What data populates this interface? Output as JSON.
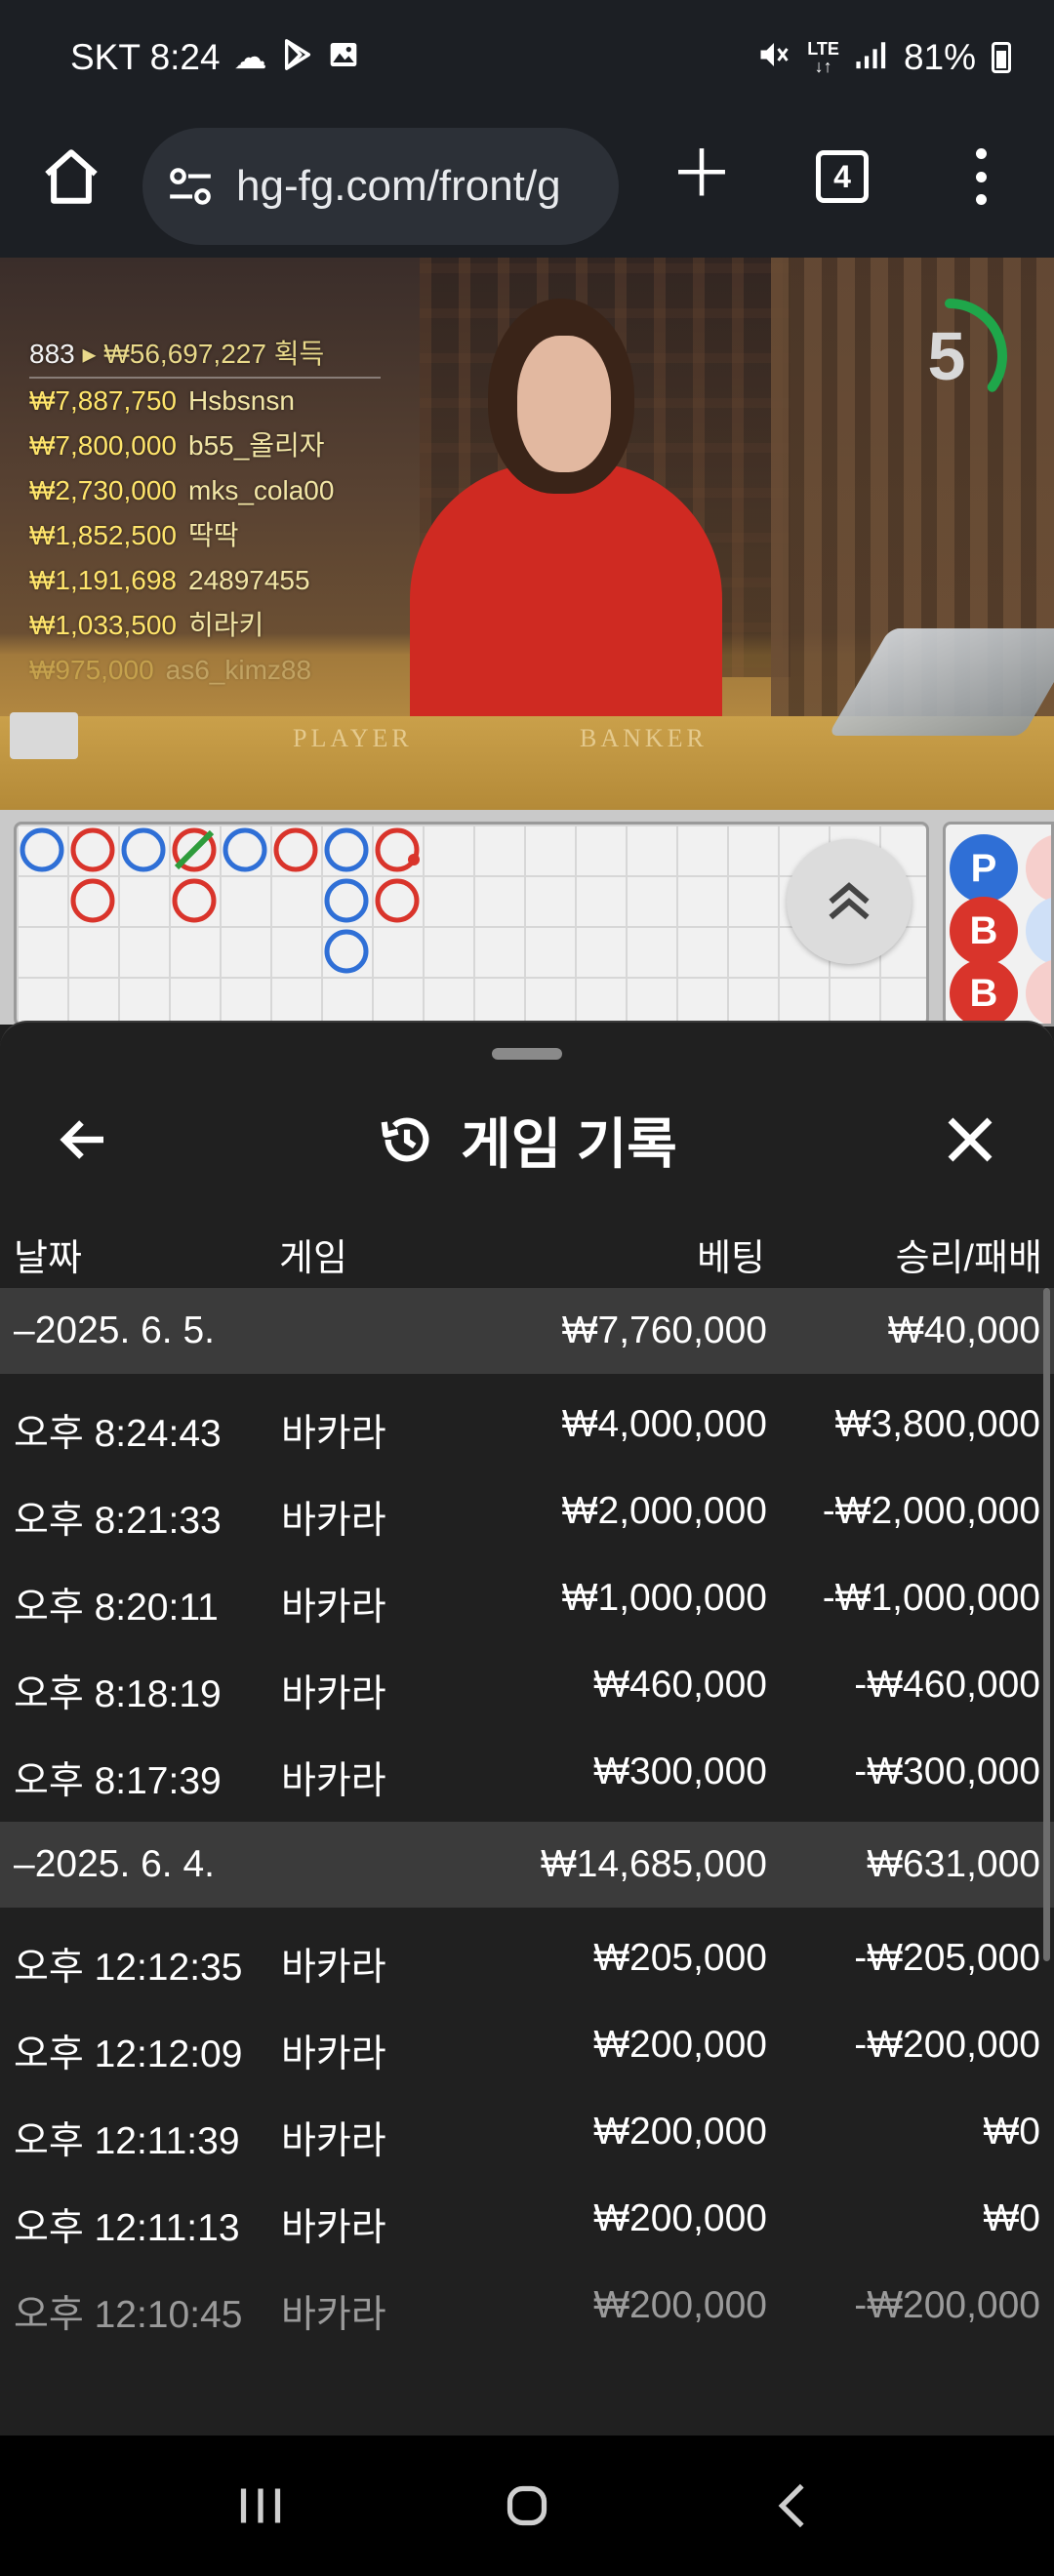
{
  "status_bar": {
    "carrier_time": "SKT 8:24",
    "left_icons": [
      "cloud-icon",
      "play-store-icon",
      "image-icon"
    ],
    "right_icons": [
      "mute-icon",
      "lte-icon",
      "signal-icon"
    ],
    "battery": "81%"
  },
  "browser": {
    "url": "hg-fg.com/front/g",
    "tab_count": "4"
  },
  "video": {
    "winners_header": {
      "count": "883",
      "total": "₩56,697,227",
      "suffix": "획득"
    },
    "winners": [
      {
        "amount": "₩7,887,750",
        "name": "Hsbsnsn"
      },
      {
        "amount": "₩7,800,000",
        "name": "b55_올리자"
      },
      {
        "amount": "₩2,730,000",
        "name": "mks_cola00"
      },
      {
        "amount": "₩1,852,500",
        "name": "딱딱"
      },
      {
        "amount": "₩1,191,698",
        "name": "24897455"
      },
      {
        "amount": "₩1,033,500",
        "name": "히라키"
      },
      {
        "amount": "₩975,000",
        "name": "as6_kimz88"
      }
    ],
    "table_labels": {
      "player": "PLAYER",
      "banker": "BANKER"
    },
    "countdown": "5",
    "countdown_fraction": 0.35
  },
  "roadmap": {
    "colors": {
      "player": "#2f6fd6",
      "banker": "#d9342b",
      "tie": "#2e9c3c"
    },
    "beads": [
      {
        "col": 0,
        "row": 0,
        "side": "player"
      },
      {
        "col": 1,
        "row": 0,
        "side": "banker"
      },
      {
        "col": 1,
        "row": 1,
        "side": "banker"
      },
      {
        "col": 2,
        "row": 0,
        "side": "player"
      },
      {
        "col": 3,
        "row": 0,
        "side": "banker",
        "tie": true
      },
      {
        "col": 3,
        "row": 1,
        "side": "banker"
      },
      {
        "col": 4,
        "row": 0,
        "side": "player"
      },
      {
        "col": 5,
        "row": 0,
        "side": "banker"
      },
      {
        "col": 6,
        "row": 0,
        "side": "player"
      },
      {
        "col": 6,
        "row": 1,
        "side": "player"
      },
      {
        "col": 6,
        "row": 2,
        "side": "player"
      },
      {
        "col": 7,
        "row": 0,
        "side": "banker",
        "pair": true
      },
      {
        "col": 7,
        "row": 1,
        "side": "banker"
      }
    ],
    "side_beads": [
      {
        "label": "P",
        "side": "player"
      },
      {
        "label": "B",
        "side": "banker"
      },
      {
        "label": "B",
        "side": "banker"
      }
    ]
  },
  "history": {
    "title": "게임 기록",
    "columns": {
      "date": "날짜",
      "game": "게임",
      "bet": "베팅",
      "result": "승리/패배"
    },
    "groups": [
      {
        "date": "–2025. 6. 5.",
        "total_bet": "₩7,760,000",
        "total_result": "₩40,000",
        "rows": [
          {
            "time": "오후 8:24:43",
            "game": "바카라",
            "bet": "₩4,000,000",
            "result": "₩3,800,000"
          },
          {
            "time": "오후 8:21:33",
            "game": "바카라",
            "bet": "₩2,000,000",
            "result": "-₩2,000,000"
          },
          {
            "time": "오후 8:20:11",
            "game": "바카라",
            "bet": "₩1,000,000",
            "result": "-₩1,000,000"
          },
          {
            "time": "오후 8:18:19",
            "game": "바카라",
            "bet": "₩460,000",
            "result": "-₩460,000"
          },
          {
            "time": "오후 8:17:39",
            "game": "바카라",
            "bet": "₩300,000",
            "result": "-₩300,000"
          }
        ]
      },
      {
        "date": "–2025. 6. 4.",
        "total_bet": "₩14,685,000",
        "total_result": "₩631,000",
        "rows": [
          {
            "time": "오후 12:12:35",
            "game": "바카라",
            "bet": "₩205,000",
            "result": "-₩205,000"
          },
          {
            "time": "오후 12:12:09",
            "game": "바카라",
            "bet": "₩200,000",
            "result": "-₩200,000"
          },
          {
            "time": "오후 12:11:39",
            "game": "바카라",
            "bet": "₩200,000",
            "result": "₩0"
          },
          {
            "time": "오후 12:11:13",
            "game": "바카라",
            "bet": "₩200,000",
            "result": "₩0"
          },
          {
            "time": "오후 12:10:45",
            "game": "바카라",
            "bet": "₩200,000",
            "result": "-₩200,000"
          }
        ]
      }
    ]
  }
}
